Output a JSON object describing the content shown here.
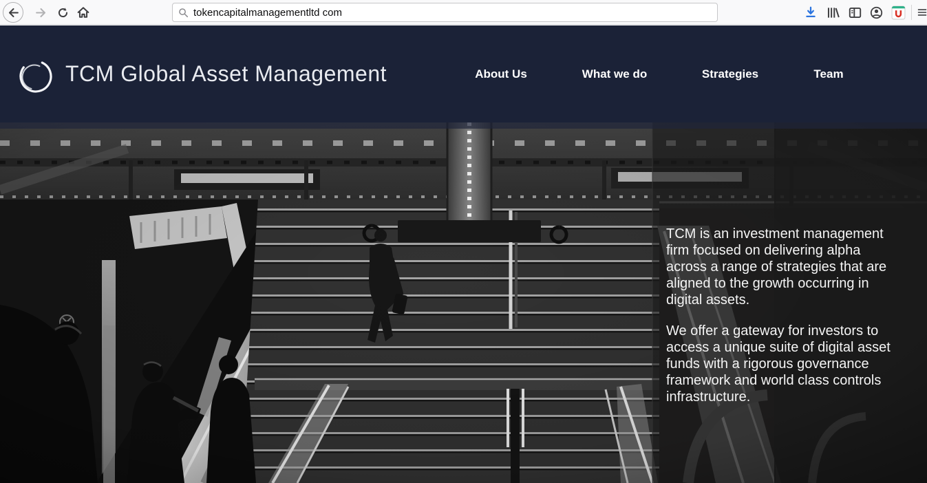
{
  "browser": {
    "url_value": "tokencapitalmanagementltd com",
    "toolbar_icons": [
      "back-arrow",
      "forward-arrow",
      "reload",
      "home",
      "search",
      "download",
      "library",
      "sidebar-reader",
      "account",
      "shopping-extension",
      "menu"
    ],
    "colors": {
      "toolbar_bg": "#f9f9fa",
      "download_accent": "#2b74df"
    }
  },
  "site": {
    "brand_name": "TCM Global Asset Management",
    "nav_items": [
      {
        "label": "About Us"
      },
      {
        "label": "What we do"
      },
      {
        "label": "Strategies"
      },
      {
        "label": "Team"
      }
    ],
    "colors": {
      "header_bg": "#1b2237",
      "nav_text": "#ffffff"
    },
    "hero": {
      "paragraph_1": "TCM is an investment management firm focused on delivering alpha across a range of strategies that are aligned to the growth occurring in digital assets.",
      "paragraph_2": "We offer a gateway for investors to access a unique suite of digital asset funds with a rigorous governance framework and world class controls infrastructure.",
      "image_alt": "Black and white photo of a man in a suit climbing stairs between escalators in a transit station"
    }
  }
}
